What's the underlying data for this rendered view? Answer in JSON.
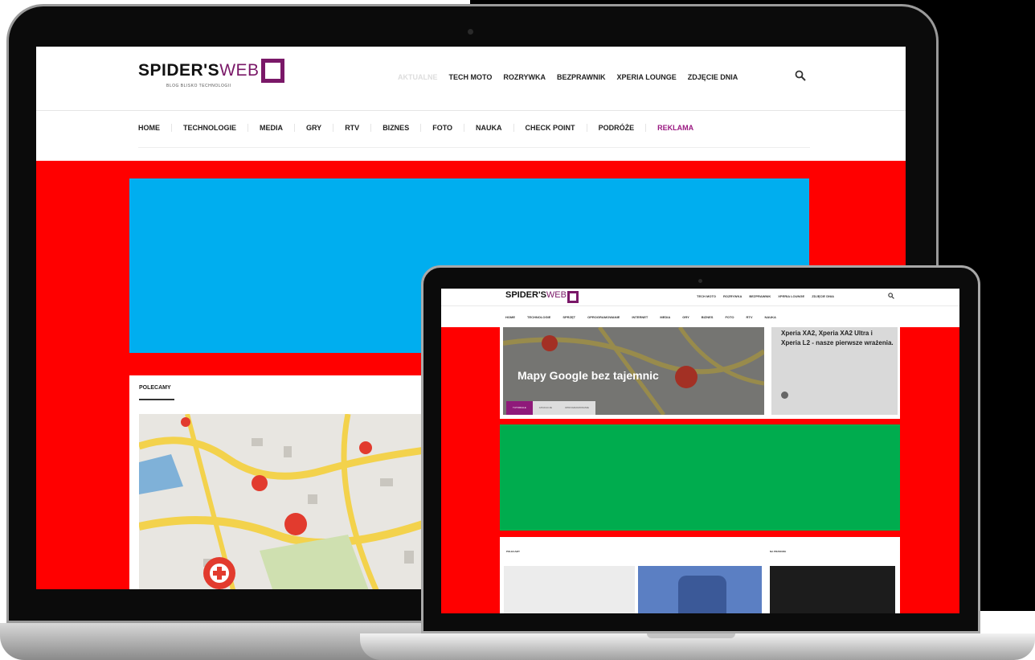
{
  "big_site": {
    "logo": {
      "word1": "SPIDER'S",
      "word2": "WEB",
      "tagline": "BLOG BLISKO TECHNOLOGII"
    },
    "top_nav": [
      "AKTUALNE",
      "TECH MOTO",
      "ROZRYWKA",
      "BEZPRAWNIK",
      "XPERIA LOUNGE",
      "ZDJĘCIE DNIA"
    ],
    "main_nav": [
      "HOME",
      "TECHNOLOGIE",
      "MEDIA",
      "GRY",
      "RTV",
      "BIZNES",
      "FOTO",
      "NAUKA",
      "CHECK POINT",
      "PODRÓŻE",
      "REKLAMA"
    ],
    "section_title": "POLECAMY"
  },
  "small_site": {
    "logo": {
      "word1": "SPIDER'S",
      "word2": "WEB"
    },
    "top_nav": [
      "TECH MOTO",
      "ROZRYWKA",
      "BEZPRAWNIK",
      "XPERIA LOUNGE",
      "ZDJĘCIE DNIA"
    ],
    "main_nav": [
      "HOME",
      "TECHNOLOGIE",
      "SPRZĘT",
      "OPROGRAMOWANIE",
      "INTERNET",
      "MEDIA",
      "GRY",
      "BIZNES",
      "FOTO",
      "RTV",
      "NAUKA"
    ],
    "hero": {
      "title": "Mapy Google bez tajemnic",
      "tabs": [
        "TUTORIALE",
        "APLIKACJE",
        "OPROGRAMOWANIE"
      ]
    },
    "side_article": {
      "title": "Xperia XA2, Xperia XA2 Ultra i Xperia L2 - nasze pierwsze wrażenia."
    },
    "sections": [
      "POLECAMY",
      "NA PRZODZIE"
    ]
  },
  "colors": {
    "background_red": "#ff0000",
    "ad_blue": "#00aeef",
    "ad_green": "#00ac4e",
    "brand_purple": "#7a1868"
  }
}
